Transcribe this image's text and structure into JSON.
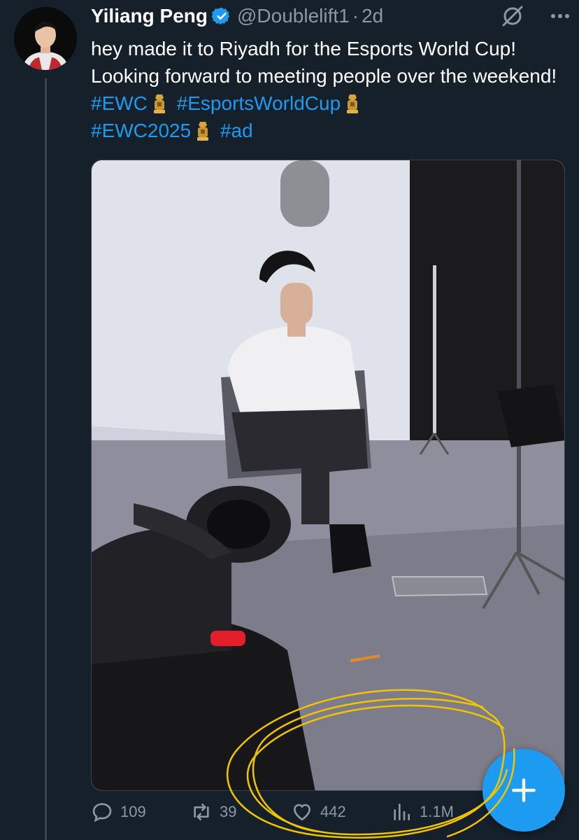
{
  "author": {
    "display_name": "Yiliang Peng",
    "handle": "@Doublelift1",
    "separator": "·",
    "time": "2d",
    "verified": true
  },
  "tweet": {
    "text_1": "hey made it to Riyadh for the Esports World Cup! Looking forward to meeting people over the weekend! ",
    "hashtag_1": "#EWC",
    "hashtag_2": "#EsportsWorldCup",
    "hashtag_3": "#EWC2025",
    "hashtag_4": "#ad"
  },
  "actions": {
    "replies": "109",
    "retweets": "39",
    "likes": "442",
    "views": "1.1M"
  },
  "icons": {
    "verified": "verified-badge-icon",
    "grok": "grok-icon",
    "more": "more-icon",
    "trophy": "trophy-emoji-icon",
    "reply": "reply-icon",
    "retweet": "retweet-icon",
    "like": "heart-icon",
    "views": "views-icon",
    "bookmark": "bookmark-icon",
    "share": "share-icon",
    "compose": "plus-icon"
  },
  "colors": {
    "background": "#15202b",
    "accent": "#1d9bf0",
    "muted": "#8b98a5",
    "annotation": "#f2c400"
  }
}
